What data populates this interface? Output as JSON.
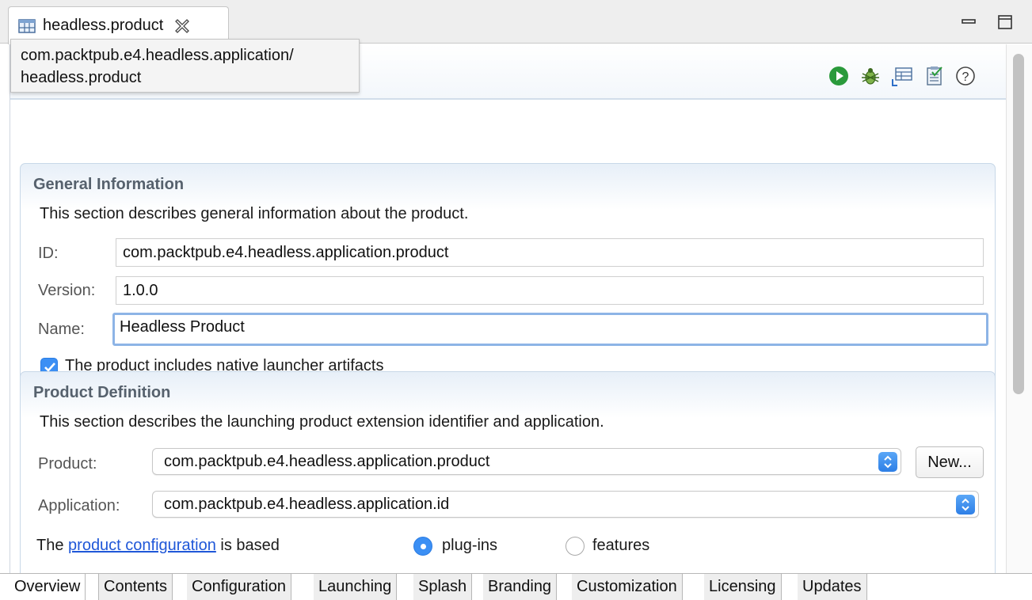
{
  "editor_tab": {
    "title": "headless.product",
    "icon": "product-file-icon"
  },
  "tooltip": {
    "line1": "com.packtpub.e4.headless.application/",
    "line2": "headless.product"
  },
  "header_toolbar": {
    "icons": [
      "run-icon",
      "debug-icon",
      "export-icon",
      "validate-icon",
      "help-icon"
    ]
  },
  "general": {
    "title": "General Information",
    "description": "This section describes general information about the product.",
    "id_label": "ID:",
    "id_value": "com.packtpub.e4.headless.application.product",
    "version_label": "Version:",
    "version_value": "1.0.0",
    "name_label": "Name:",
    "name_value": "Headless Product",
    "native_launcher_label": "The product includes native launcher artifacts",
    "native_launcher_checked": true
  },
  "product_definition": {
    "title": "Product Definition",
    "description": "This section describes the launching product extension identifier and application.",
    "product_label": "Product:",
    "product_value": "com.packtpub.e4.headless.application.product",
    "new_button": "New...",
    "application_label": "Application:",
    "application_value": "com.packtpub.e4.headless.application.id",
    "config_prefix": "The",
    "config_link": "product configuration",
    "config_suffix": "is based",
    "option_plugins": "plug-ins",
    "option_features": "features",
    "selected_option": "plug-ins"
  },
  "page_tabs": [
    "Overview",
    "Contents",
    "Configuration",
    "Launching",
    "Splash",
    "Branding",
    "Customization",
    "Licensing",
    "Updates"
  ],
  "active_page_tab": "Overview",
  "colors": {
    "accent": "#3b8ff4",
    "link": "#1f57d8",
    "section_title": "#56616d",
    "run_green": "#2a9a3b"
  }
}
